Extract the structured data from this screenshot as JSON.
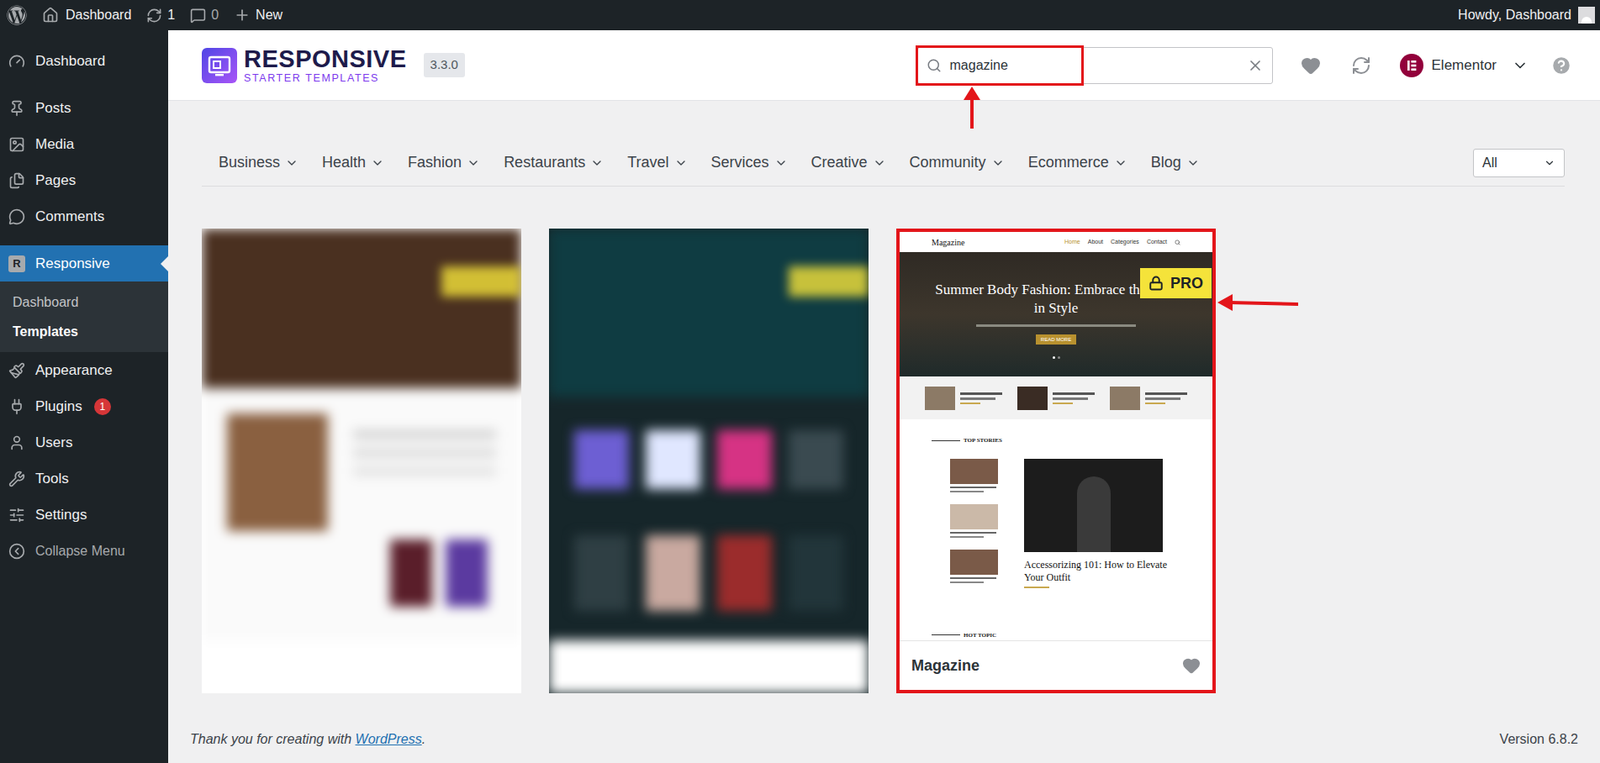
{
  "admin_bar": {
    "site": "Dashboard",
    "updates": "1",
    "comments": "0",
    "new": "New",
    "greeting": "Howdy, Dashboard"
  },
  "sidebar": {
    "items": [
      {
        "label": "Dashboard",
        "selected": false
      },
      {
        "label": "Posts",
        "selected": false
      },
      {
        "label": "Media",
        "selected": false
      },
      {
        "label": "Pages",
        "selected": false
      },
      {
        "label": "Comments",
        "selected": false
      },
      {
        "label": "Responsive",
        "selected": true,
        "logo_letter": "R",
        "submenu": [
          {
            "label": "Dashboard",
            "selected": false
          },
          {
            "label": "Templates",
            "selected": true
          }
        ]
      },
      {
        "label": "Appearance",
        "selected": false
      },
      {
        "label": "Plugins",
        "selected": false,
        "badge": "1"
      },
      {
        "label": "Users",
        "selected": false
      },
      {
        "label": "Tools",
        "selected": false
      },
      {
        "label": "Settings",
        "selected": false
      }
    ],
    "collapse": "Collapse Menu"
  },
  "header": {
    "logo_title": "RESPONSIVE",
    "logo_subtitle": "STARTER TEMPLATES",
    "version": "3.3.0",
    "search": {
      "value": "magazine",
      "highlighted": true
    },
    "builder": "Elementor"
  },
  "categories": [
    "Business",
    "Health",
    "Fashion",
    "Restaurants",
    "Travel",
    "Services",
    "Creative",
    "Community",
    "Ecommerce",
    "Blog"
  ],
  "filter": {
    "value": "All"
  },
  "cards": [
    {
      "kind": "blurred",
      "pro": true
    },
    {
      "kind": "blurred",
      "pro": true
    },
    {
      "kind": "template",
      "title": "Magazine",
      "badge": "PRO",
      "pro": true,
      "highlighted": true,
      "favorite": false,
      "preview": {
        "site": "Magazine",
        "nav": [
          {
            "label": "Home",
            "selected": true
          },
          {
            "label": "About",
            "selected": false
          },
          {
            "label": "Categories",
            "selected": false
          },
          {
            "label": "Contact",
            "selected": false
          }
        ],
        "hero_title": "Summer Body Fashion: Embrace the Heat in Style",
        "hero_button": "READ MORE",
        "section": "TOP STORIES",
        "feature_title": "Accessorizing 101: How to Elevate Your Outfit",
        "next_section": "HOT TOPIC"
      }
    }
  ],
  "footer": {
    "thanks": "Thank you for creating with ",
    "link": "WordPress",
    "end": ".",
    "version": "Version 6.8.2"
  }
}
